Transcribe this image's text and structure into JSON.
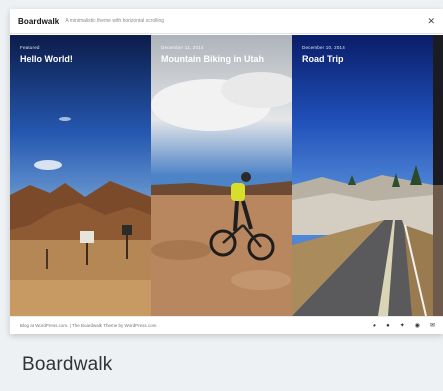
{
  "header": {
    "title": "Boardwalk",
    "tagline": "A minimalistic theme with horizontal scrolling",
    "close_icon": "close-icon"
  },
  "posts": [
    {
      "date": "Featured",
      "title": "Hello World!"
    },
    {
      "date": "December 11, 2014",
      "title": "Mountain Biking in Utah"
    },
    {
      "date": "December 10, 2014",
      "title": "Road Trip"
    }
  ],
  "footer": {
    "credit": "Blog at WordPress.com. | The Boardwalk Theme by WordPress.com.",
    "social_icons": [
      "wordpress-icon",
      "github-icon",
      "twitter-icon",
      "instagram-icon",
      "email-icon"
    ]
  },
  "page_heading": "Boardwalk"
}
